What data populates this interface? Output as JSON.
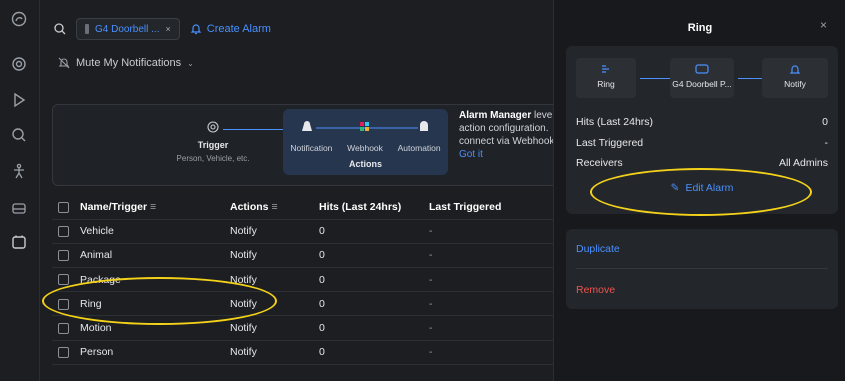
{
  "topbar": {
    "chip_label": "G4 Doorbell ...",
    "chip_close": "×",
    "create_alarm": "Create Alarm"
  },
  "mute": {
    "label": "Mute My Notifications"
  },
  "flow": {
    "trigger_title": "Trigger",
    "trigger_sub": "Person, Vehicle, etc.",
    "actions": [
      "Notification",
      "Webhook",
      "Automation"
    ],
    "actions_label": "Actions",
    "info_bold": "Alarm Manager",
    "info_rest1": " leve",
    "info_line2": "action configuration.",
    "info_line3": "connect via Webhook",
    "info_link": "Got it"
  },
  "table": {
    "headers": [
      "Name/Trigger",
      "Actions",
      "Hits (Last 24hrs)",
      "Last Triggered"
    ],
    "rows": [
      {
        "name": "Vehicle",
        "action": "Notify",
        "hits": "0",
        "last": "-"
      },
      {
        "name": "Animal",
        "action": "Notify",
        "hits": "0",
        "last": "-"
      },
      {
        "name": "Package",
        "action": "Notify",
        "hits": "0",
        "last": "-"
      },
      {
        "name": "Ring",
        "action": "Notify",
        "hits": "0",
        "last": "-"
      },
      {
        "name": "Motion",
        "action": "Notify",
        "hits": "0",
        "last": "-"
      },
      {
        "name": "Person",
        "action": "Notify",
        "hits": "0",
        "last": "-"
      }
    ]
  },
  "panel": {
    "title": "Ring",
    "close": "×",
    "nodes": [
      "Ring",
      "G4 Doorbell P...",
      "Notify"
    ],
    "hits_label": "Hits (Last 24hrs)",
    "hits_value": "0",
    "last_label": "Last Triggered",
    "last_value": "-",
    "receivers_label": "Receivers",
    "receivers_value": "All Admins",
    "edit": "Edit Alarm",
    "duplicate": "Duplicate",
    "remove": "Remove"
  },
  "colors": {
    "accent": "#4a90ff",
    "danger": "#ef5350",
    "highlight": "#f4d21a"
  }
}
